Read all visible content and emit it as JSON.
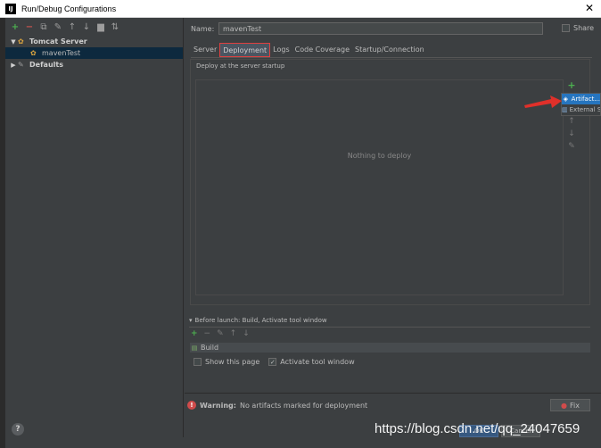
{
  "window": {
    "title": "Run/Debug Configurations",
    "app_icon": "IJ",
    "close": "✕"
  },
  "toolbar": {
    "buttons": [
      {
        "name": "add",
        "glyph": "+"
      },
      {
        "name": "remove",
        "glyph": "−"
      },
      {
        "name": "copy",
        "glyph": "⧉"
      },
      {
        "name": "edit-defaults",
        "glyph": "✎"
      },
      {
        "name": "move-up",
        "glyph": "↑"
      },
      {
        "name": "move-down",
        "glyph": "↓"
      },
      {
        "name": "folder",
        "glyph": "▆"
      },
      {
        "name": "sort",
        "glyph": "⇅"
      }
    ]
  },
  "tree": {
    "tomcat_server": "Tomcat Server",
    "maven_test": "mavenTest",
    "defaults": "Defaults"
  },
  "config": {
    "name_label": "Name:",
    "name_value": "mavenTest",
    "share_label": "Share"
  },
  "tabs": [
    "Server",
    "Deployment",
    "Logs",
    "Code Coverage",
    "Startup/Connection"
  ],
  "active_tab": "Deployment",
  "deployment": {
    "section_label": "Deploy at the server startup",
    "empty_text": "Nothing to deploy"
  },
  "popup": {
    "items": [
      {
        "label": "Artifact...",
        "icon": "artifact-icon"
      },
      {
        "label": "External Source...",
        "icon": "external-source-icon"
      }
    ]
  },
  "before_launch": {
    "label": "Before launch: Build, Activate tool window",
    "item": "Build",
    "show_page": "Show this page",
    "activate_tool_window": "Activate tool window"
  },
  "warning": {
    "prefix": "Warning:",
    "text": "No artifacts marked for deployment",
    "fix": "Fix"
  },
  "buttons": {
    "ok": "OK",
    "cancel": "Cancel"
  },
  "help": "?",
  "watermark": "https://blog.csdn.net/qq_24047659",
  "colors": {
    "background": "#3c3f41",
    "accent": "#4caf50",
    "selection": "#2675bf",
    "warning": "#d04b4b"
  }
}
